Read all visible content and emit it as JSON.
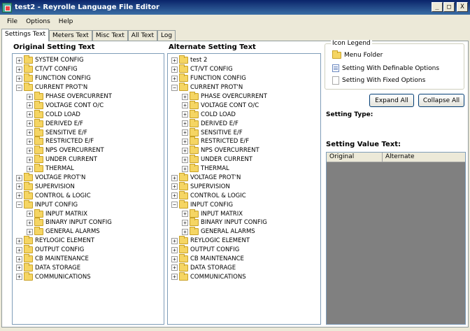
{
  "window": {
    "title": "test2 - Reyrolle Language File Editor",
    "buttons": [
      "_",
      "□",
      "X"
    ]
  },
  "menu": [
    "File",
    "Options",
    "Help"
  ],
  "tabs": [
    {
      "label": "Settings Text",
      "active": true
    },
    {
      "label": "Meters Text",
      "active": false
    },
    {
      "label": "Misc Text",
      "active": false
    },
    {
      "label": "All Text",
      "active": false
    },
    {
      "label": "Log",
      "active": false
    }
  ],
  "original": {
    "title": "Original Setting Text",
    "items": [
      {
        "label": "SYSTEM CONFIG",
        "expander": "+",
        "level": 0
      },
      {
        "label": "CT/VT CONFIG",
        "expander": "+",
        "level": 0
      },
      {
        "label": "FUNCTION CONFIG",
        "expander": "+",
        "level": 0
      },
      {
        "label": "CURRENT PROT'N",
        "expander": "−",
        "level": 0
      },
      {
        "label": "PHASE OVERCURRENT",
        "expander": "+",
        "level": 1
      },
      {
        "label": "VOLTAGE CONT O/C",
        "expander": "+",
        "level": 1
      },
      {
        "label": "COLD LOAD",
        "expander": "+",
        "level": 1
      },
      {
        "label": "DERIVED E/F",
        "expander": "+",
        "level": 1
      },
      {
        "label": "SENSITIVE E/F",
        "expander": "+",
        "level": 1
      },
      {
        "label": "RESTRICTED E/F",
        "expander": "+",
        "level": 1
      },
      {
        "label": "NPS OVERCURRENT",
        "expander": "+",
        "level": 1
      },
      {
        "label": "UNDER CURRENT",
        "expander": "+",
        "level": 1
      },
      {
        "label": "THERMAL",
        "expander": "+",
        "level": 1
      },
      {
        "label": "VOLTAGE PROT'N",
        "expander": "+",
        "level": 0
      },
      {
        "label": "SUPERVISION",
        "expander": "+",
        "level": 0
      },
      {
        "label": "CONTROL & LOGIC",
        "expander": "+",
        "level": 0
      },
      {
        "label": "INPUT CONFIG",
        "expander": "−",
        "level": 0
      },
      {
        "label": "INPUT MATRIX",
        "expander": "+",
        "level": 1
      },
      {
        "label": "BINARY INPUT CONFIG",
        "expander": "+",
        "level": 1
      },
      {
        "label": "GENERAL ALARMS",
        "expander": "+",
        "level": 1
      },
      {
        "label": "REYLOGIC ELEMENT",
        "expander": "+",
        "level": 0
      },
      {
        "label": "OUTPUT CONFIG",
        "expander": "+",
        "level": 0
      },
      {
        "label": "CB MAINTENANCE",
        "expander": "+",
        "level": 0
      },
      {
        "label": "DATA STORAGE",
        "expander": "+",
        "level": 0
      },
      {
        "label": "COMMUNICATIONS",
        "expander": "+",
        "level": 0
      }
    ]
  },
  "alternate": {
    "title": "Alternate Setting Text",
    "items": [
      {
        "label": "test 2",
        "expander": "+",
        "level": 0
      },
      {
        "label": "CT/VT CONFIG",
        "expander": "+",
        "level": 0
      },
      {
        "label": "FUNCTION CONFIG",
        "expander": "+",
        "level": 0
      },
      {
        "label": "CURRENT PROT'N",
        "expander": "−",
        "level": 0
      },
      {
        "label": "PHASE OVERCURRENT",
        "expander": "+",
        "level": 1
      },
      {
        "label": "VOLTAGE CONT O/C",
        "expander": "+",
        "level": 1
      },
      {
        "label": "COLD LOAD",
        "expander": "+",
        "level": 1
      },
      {
        "label": "DERIVED E/F",
        "expander": "+",
        "level": 1
      },
      {
        "label": "SENSITIVE E/F",
        "expander": "+",
        "level": 1
      },
      {
        "label": "RESTRICTED E/F",
        "expander": "+",
        "level": 1
      },
      {
        "label": "NPS OVERCURRENT",
        "expander": "+",
        "level": 1
      },
      {
        "label": "UNDER CURRENT",
        "expander": "+",
        "level": 1
      },
      {
        "label": "THERMAL",
        "expander": "+",
        "level": 1
      },
      {
        "label": "VOLTAGE PROT'N",
        "expander": "+",
        "level": 0
      },
      {
        "label": "SUPERVISION",
        "expander": "+",
        "level": 0
      },
      {
        "label": "CONTROL & LOGIC",
        "expander": "+",
        "level": 0
      },
      {
        "label": "INPUT CONFIG",
        "expander": "−",
        "level": 0
      },
      {
        "label": "INPUT MATRIX",
        "expander": "+",
        "level": 1
      },
      {
        "label": "BINARY INPUT CONFIG",
        "expander": "+",
        "level": 1
      },
      {
        "label": "GENERAL ALARMS",
        "expander": "+",
        "level": 1
      },
      {
        "label": "REYLOGIC ELEMENT",
        "expander": "+",
        "level": 0
      },
      {
        "label": "OUTPUT CONFIG",
        "expander": "+",
        "level": 0
      },
      {
        "label": "CB MAINTENANCE",
        "expander": "+",
        "level": 0
      },
      {
        "label": "DATA STORAGE",
        "expander": "+",
        "level": 0
      },
      {
        "label": "COMMUNICATIONS",
        "expander": "+",
        "level": 0
      }
    ]
  },
  "legend": {
    "title": "Icon Legend",
    "menu_folder": "Menu Folder",
    "definable": "Setting With Definable Options",
    "fixed": "Setting With Fixed Options"
  },
  "buttons": {
    "expand_all": "Expand All",
    "collapse_all": "Collapse All"
  },
  "setting_type_label": "Setting Type:",
  "setting_value_label": "Setting Value Text:",
  "value_columns": [
    "Original",
    "Alternate"
  ],
  "colors": {
    "titlebar_start": "#0a246a",
    "titlebar_end": "#3a6ea5",
    "folder": "#f5d563",
    "value_box": "#808080"
  }
}
